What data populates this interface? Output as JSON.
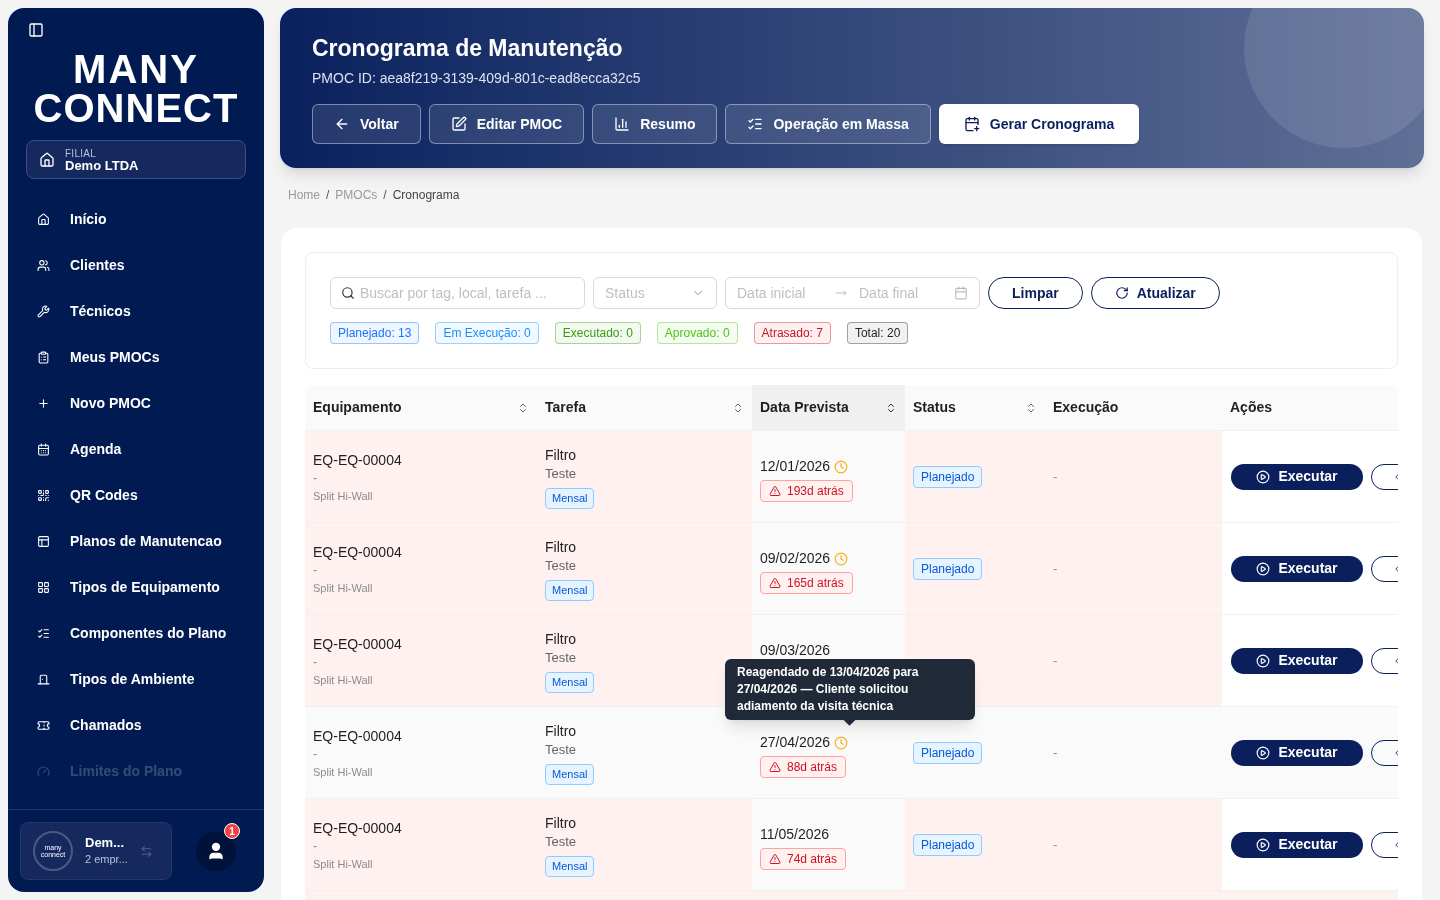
{
  "sidebar": {
    "logo": {
      "line_1": "MANY",
      "line_2": "CONNECT"
    },
    "branch": {
      "label": "FILIAL",
      "name": "Demo LTDA"
    },
    "items": [
      {
        "kind": "home",
        "label": "Início",
        "faded": false
      },
      {
        "kind": "users",
        "label": "Clientes",
        "faded": false
      },
      {
        "kind": "wrench",
        "label": "Técnicos",
        "faded": false
      },
      {
        "kind": "clipboard",
        "label": "Meus PMOCs",
        "faded": false
      },
      {
        "kind": "plus",
        "label": "Novo PMOC",
        "faded": false
      },
      {
        "kind": "calendar",
        "label": "Agenda",
        "faded": false
      },
      {
        "kind": "qr",
        "label": "QR Codes",
        "faded": false
      },
      {
        "kind": "template",
        "label": "Planos de Manutencao",
        "faded": false
      },
      {
        "kind": "grid",
        "label": "Tipos de Equipamento",
        "faded": false
      },
      {
        "kind": "checklist",
        "label": "Componentes do Plano",
        "faded": false
      },
      {
        "kind": "door",
        "label": "Tipos de Ambiente",
        "faded": false
      },
      {
        "kind": "ticket",
        "label": "Chamados",
        "faded": false
      },
      {
        "kind": "gauge",
        "label": "Limites do Plano",
        "faded": true
      }
    ],
    "account": {
      "avatar_line_1": "many",
      "avatar_line_2": "connect",
      "name": "Dem...",
      "detail": "2 empr..."
    },
    "notifications": {
      "count": "1"
    }
  },
  "header": {
    "title": "Cronograma de Manutenção",
    "subtitle": "PMOC ID: aea8f219-3139-409d-801c-ead8ecca32c5",
    "buttons": [
      {
        "kind": "back",
        "label": "Voltar",
        "primary": false
      },
      {
        "kind": "edit",
        "label": "Editar PMOC",
        "primary": false
      },
      {
        "kind": "chart",
        "label": "Resumo",
        "primary": false
      },
      {
        "kind": "list",
        "label": "Operação em Massa",
        "primary": false
      },
      {
        "kind": "calendar",
        "label": "Gerar Cronograma",
        "primary": true
      }
    ]
  },
  "breadcrumb": [
    {
      "label": "Home",
      "current": false
    },
    {
      "separator": "/"
    },
    {
      "label": "PMOCs",
      "current": false
    },
    {
      "separator": "/"
    },
    {
      "label": "Cronograma",
      "current": true
    }
  ],
  "filters": {
    "search": {
      "placeholder": "Buscar por tag, local, tarefa ..."
    },
    "status": {
      "placeholder": "Status"
    },
    "date_range": {
      "start_placeholder": "Data inicial",
      "end_placeholder": "Data final"
    },
    "clear_button": "Limpar",
    "refresh_button": "Atualizar",
    "chips": [
      {
        "label": "Planejado: 13",
        "color": "#1677ff"
      },
      {
        "label": "Em Execução: 0",
        "color": "#1890ff"
      },
      {
        "label": "Executado: 0",
        "color": "#389e0d"
      },
      {
        "label": "Aprovado: 0",
        "color": "#52c41a"
      },
      {
        "label": "Atrasado: 7",
        "color": "#cf1322"
      },
      {
        "label": "Total: 20",
        "color": "#262626"
      }
    ]
  },
  "table": {
    "columns": [
      {
        "label": "Equipamento",
        "sortable": true,
        "sorted": false
      },
      {
        "label": "Tarefa",
        "sortable": true,
        "sorted": false
      },
      {
        "label": "Data Prevista",
        "sortable": true,
        "sorted": true
      },
      {
        "label": "Status",
        "sortable": true,
        "sorted": false
      },
      {
        "label": "Execução",
        "sortable": false
      },
      {
        "label": "Ações",
        "sortable": false
      }
    ],
    "rows": [
      {
        "equipment": "EQ-EQ-00004",
        "location": "-",
        "type": "Split Hi-Wall",
        "task": "Filtro",
        "task_detail": "Teste",
        "frequency": "Mensal",
        "date": "12/01/2026",
        "rescheduled": true,
        "overdue": "193d atrás",
        "status": "Planejado",
        "execution": "-",
        "action": "Executar",
        "kind": "overdue"
      },
      {
        "equipment": "EQ-EQ-00004",
        "location": "-",
        "type": "Split Hi-Wall",
        "task": "Filtro",
        "task_detail": "Teste",
        "frequency": "Mensal",
        "date": "09/02/2026",
        "rescheduled": true,
        "overdue": "165d atrás",
        "status": "Planejado",
        "execution": "-",
        "action": "Executar",
        "kind": "overdue"
      },
      {
        "equipment": "EQ-EQ-00004",
        "location": "-",
        "type": "Split Hi-Wall",
        "task": "Filtro",
        "task_detail": "Teste",
        "frequency": "Mensal",
        "date": "09/03/2026",
        "rescheduled": false,
        "execution": "-",
        "action": "Executar",
        "kind": "overdue"
      },
      {
        "equipment": "EQ-EQ-00004",
        "location": "-",
        "type": "Split Hi-Wall",
        "task": "Filtro",
        "task_detail": "Teste",
        "frequency": "Mensal",
        "date": "27/04/2026",
        "rescheduled": true,
        "overdue": "88d atrás",
        "status": "Planejado",
        "execution": "-",
        "action": "Executar",
        "kind": "hover",
        "tooltip": "Reagendado de 13/04/2026 para 27/04/2026 — Cliente solicitou adiamento da visita técnica"
      },
      {
        "equipment": "EQ-EQ-00004",
        "location": "-",
        "type": "Split Hi-Wall",
        "task": "Filtro",
        "task_detail": "Teste",
        "frequency": "Mensal",
        "date": "11/05/2026",
        "rescheduled": false,
        "overdue": "74d atrás",
        "status": "Planejado",
        "execution": "-",
        "action": "Executar",
        "kind": "overdue"
      }
    ]
  }
}
